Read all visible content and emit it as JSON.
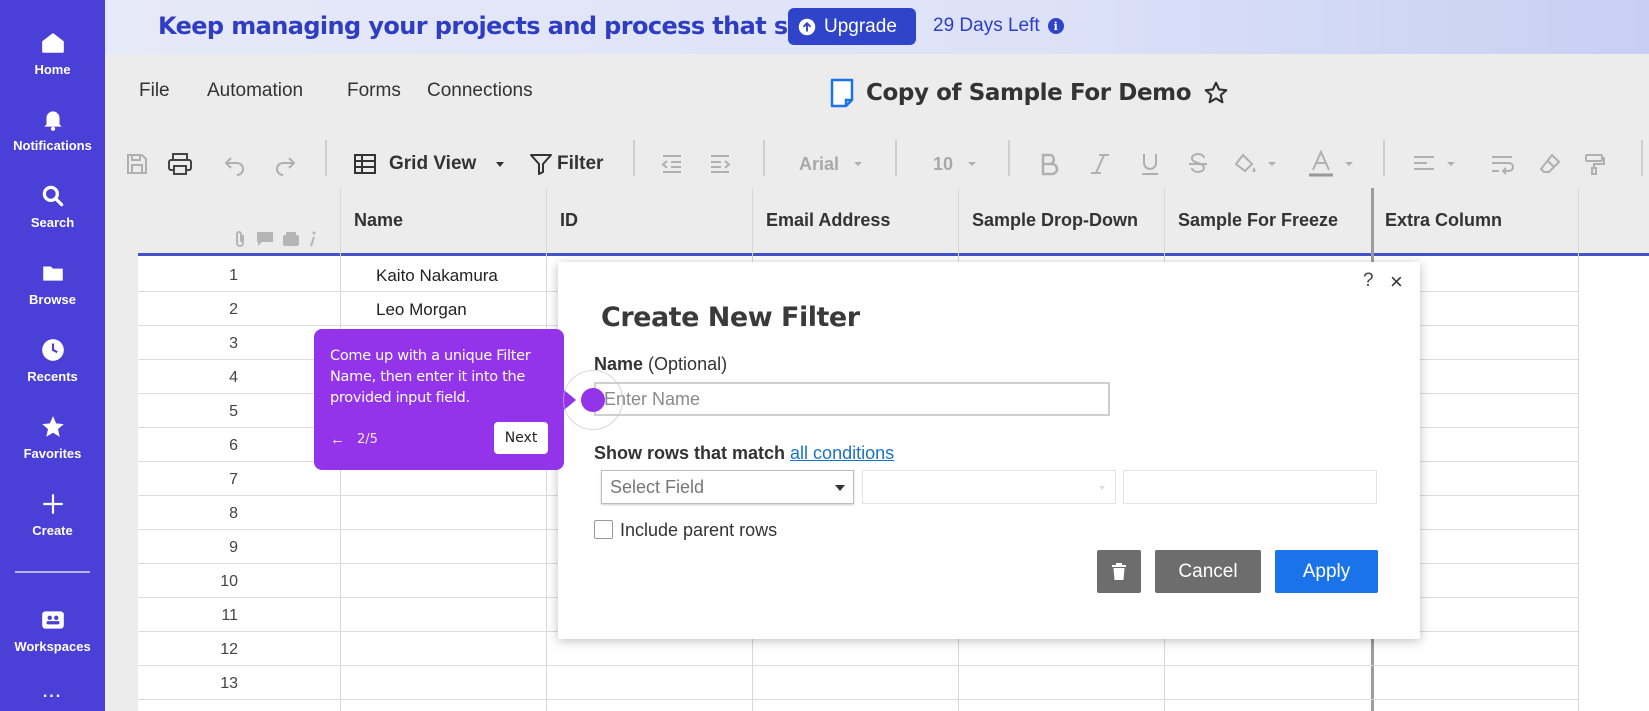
{
  "leftnav": {
    "items": [
      {
        "label": "Home",
        "icon": "home-icon"
      },
      {
        "label": "Notifications",
        "icon": "bell-icon"
      },
      {
        "label": "Search",
        "icon": "search-icon"
      },
      {
        "label": "Browse",
        "icon": "folder-icon"
      },
      {
        "label": "Recents",
        "icon": "clock-icon"
      },
      {
        "label": "Favorites",
        "icon": "star-icon"
      },
      {
        "label": "Create",
        "icon": "plus-icon"
      },
      {
        "label": "Workspaces",
        "icon": "workspaces-icon"
      }
    ],
    "more": "..."
  },
  "banner": {
    "text": "Keep managing your projects and process that scale.",
    "upgrade_label": "Upgrade",
    "days_left": "29 Days Left",
    "info": "i"
  },
  "menu": {
    "items": [
      "File",
      "Automation",
      "Forms",
      "Connections"
    ]
  },
  "document": {
    "title": "Copy of Sample For Demo"
  },
  "toolbar": {
    "view_label": "Grid View",
    "filter_label": "Filter",
    "font_name": "Arial",
    "font_size": "10"
  },
  "grid": {
    "columns": [
      "Name",
      "ID",
      "Email Address",
      "Sample Drop-Down",
      "Sample For Freeze",
      "Extra Column"
    ],
    "rows": [
      {
        "num": "1",
        "name": "Kaito Nakamura"
      },
      {
        "num": "2",
        "name": "Leo Morgan"
      },
      {
        "num": "3",
        "name": ""
      },
      {
        "num": "4",
        "name": ""
      },
      {
        "num": "5",
        "name": ""
      },
      {
        "num": "6",
        "name": ""
      },
      {
        "num": "7",
        "name": ""
      },
      {
        "num": "8",
        "name": ""
      },
      {
        "num": "9",
        "name": ""
      },
      {
        "num": "10",
        "name": ""
      },
      {
        "num": "11",
        "name": ""
      },
      {
        "num": "12",
        "name": ""
      },
      {
        "num": "13",
        "name": ""
      }
    ]
  },
  "modal": {
    "title": "Create New Filter",
    "help": "?",
    "close": "×",
    "name_label": "Name",
    "name_optional": "(Optional)",
    "name_placeholder": "Enter Name",
    "match_label": "Show rows that match",
    "match_link": "all conditions",
    "select_field_placeholder": "Select Field",
    "include_parent_label": "Include parent rows",
    "cancel_label": "Cancel",
    "apply_label": "Apply"
  },
  "tooltip": {
    "text": "Come up with a unique Filter Name, then enter it into the provided input field.",
    "back": "←",
    "step": "2/5",
    "next_label": "Next"
  },
  "colors": {
    "nav_bg": "#4a3fd6",
    "accent_blue": "#2f44c9",
    "apply_blue": "#1a73e8",
    "tooltip_purple": "#9333ea",
    "cancel_grey": "#6d6d6d"
  }
}
